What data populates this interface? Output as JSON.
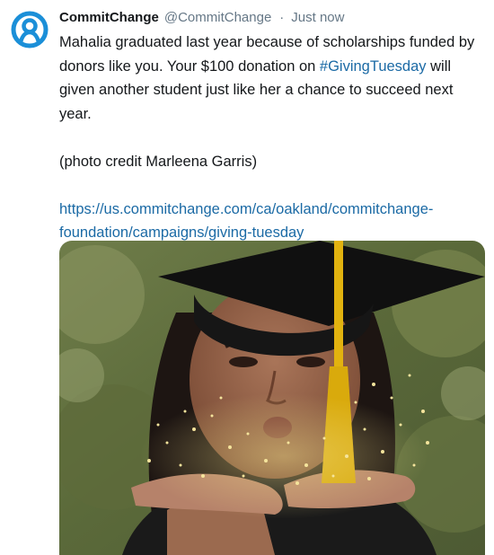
{
  "tweet": {
    "display_name": "CommitChange",
    "handle": "@CommitChange",
    "separator": "·",
    "timestamp": "Just now",
    "text_line1_before": "Mahalia graduated last year because of scholarships funded by donors like you. Your $100 donation on ",
    "hashtag": "#GivingTuesday",
    "text_line1_after": " will given another student just like her a chance to succeed next year.",
    "photo_credit": "(photo credit Marleena Garris)",
    "link": "https://us.commitchange.com/ca/oakland/commitchange-foundation/campaigns/giving-tuesday"
  },
  "icons": {
    "avatar": "commitchange-logo-icon"
  },
  "colors": {
    "brand": "#1b8fd8",
    "link": "#1b6aa5",
    "meta": "#657786",
    "text": "#14171a",
    "tassel": "#e2b30f"
  }
}
